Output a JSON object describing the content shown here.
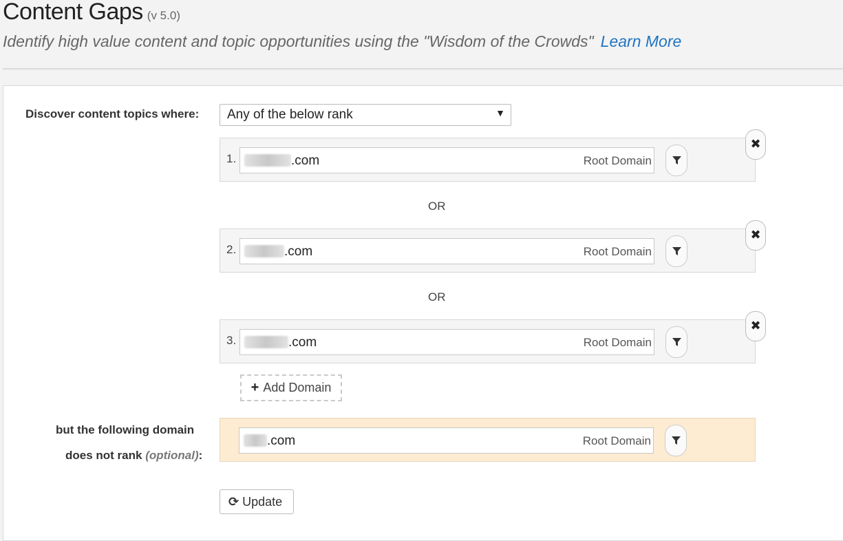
{
  "header": {
    "title": "Content Gaps",
    "version": "(v 5.0)",
    "subtitle": "Identify high value content and topic opportunities using the \"Wisdom of the Crowds\"",
    "learn_more": "Learn More"
  },
  "form": {
    "discover_label": "Discover content topics where:",
    "rank_select": "Any of the below rank",
    "separator": "OR",
    "domains": [
      {
        "num": "1.",
        "value": ".com",
        "type": "Root Domain"
      },
      {
        "num": "2.",
        "value": ".com",
        "type": "Root Domain"
      },
      {
        "num": "3.",
        "value": ".com",
        "type": "Root Domain"
      }
    ],
    "add_domain": "Add Domain",
    "exclude_label_1": "but the following domain",
    "exclude_label_2": "does not rank",
    "exclude_optional": "(optional)",
    "exclude_colon": ":",
    "exclude_domain": {
      "value": ".com",
      "type": "Root Domain"
    },
    "update": "Update"
  },
  "icons": {
    "filter": "filter-icon",
    "close": "close-icon",
    "plus": "plus-icon",
    "refresh": "refresh-icon",
    "dropdown": "caret-down-icon"
  },
  "colors": {
    "link": "#1f74c0",
    "exclude_bg": "#fdebd2"
  }
}
